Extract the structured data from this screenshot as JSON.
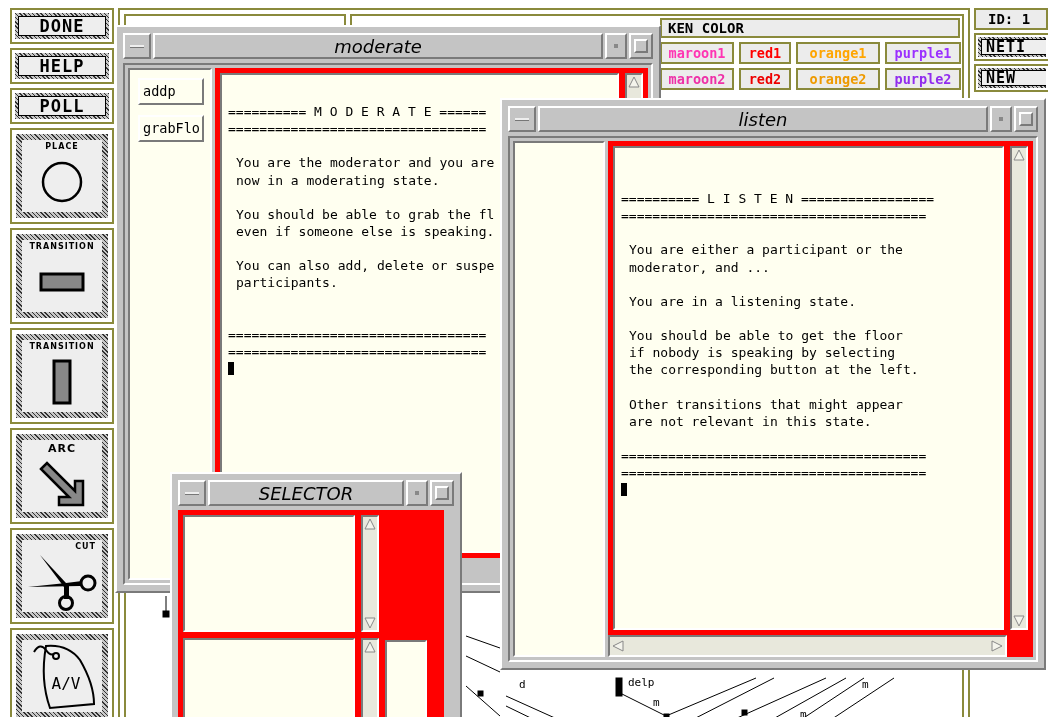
{
  "toolbar": {
    "buttons": [
      "DONE",
      "HELP",
      "POLL"
    ],
    "tools": [
      {
        "kind": "place",
        "label": "PLACE"
      },
      {
        "kind": "transition_horizontal",
        "label": "TRANSITION"
      },
      {
        "kind": "transition_vertical",
        "label": "TRANSITION"
      },
      {
        "kind": "arc",
        "label": "ARC"
      },
      {
        "kind": "cut",
        "label": "CUT"
      },
      {
        "kind": "tag",
        "label": "A/V"
      }
    ]
  },
  "color_panel": {
    "header": "KEN COLOR",
    "colors": [
      {
        "label": "maroon1",
        "color": "#ff34b3"
      },
      {
        "label": "red1",
        "color": "#ff0000"
      },
      {
        "label": "orange1",
        "color": "#ffa500"
      },
      {
        "label": "purple1",
        "color": "#9b30ff"
      },
      {
        "label": "maroon2",
        "color": "#ee30a7"
      },
      {
        "label": "red2",
        "color": "#ee0000"
      },
      {
        "label": "orange2",
        "color": "#ee9a00"
      },
      {
        "label": "purple2",
        "color": "#912cee"
      }
    ]
  },
  "side_panel": {
    "id": "ID: 1",
    "buttons": [
      "NETI",
      "NEW"
    ]
  },
  "diagram": {
    "labels": [
      "d",
      "delp",
      "m",
      "m",
      "m"
    ]
  },
  "windows": [
    {
      "kind": "text_window",
      "title": "moderate",
      "side_buttons": [
        "addp",
        "grabFlo"
      ],
      "cursor": true,
      "blocks": [
        {
          "kind": "rule",
          "text": "========== M O D E R A T E ======"
        },
        {
          "kind": "rule",
          "text": "================================="
        },
        {
          "kind": "paragraph",
          "text": "You are the moderator and you are\nnow in a moderating state."
        },
        {
          "kind": "paragraph",
          "text": "You should be able to grab the fl\neven if someone else is speaking."
        },
        {
          "kind": "paragraph",
          "text": "You can also add, delete or suspe\nparticipants."
        },
        {
          "kind": "rule",
          "text": "================================="
        },
        {
          "kind": "rule",
          "text": "================================="
        }
      ]
    },
    {
      "kind": "text_window",
      "title": "listen",
      "cursor": true,
      "blocks": [
        {
          "kind": "rule",
          "text": "========== L I S T E N ================="
        },
        {
          "kind": "rule",
          "text": "======================================="
        },
        {
          "kind": "paragraph",
          "text": "You are either a participant or the\nmoderator, and ..."
        },
        {
          "kind": "paragraph",
          "text": "You are in a listening state."
        },
        {
          "kind": "paragraph",
          "text": "You should be able to get the floor\nif nobody is speaking by selecting\nthe corresponding button at the left."
        },
        {
          "kind": "paragraph",
          "text": "Other transitions that might appear\nare not relevant in this state."
        },
        {
          "kind": "rule",
          "text": "======================================="
        },
        {
          "kind": "rule",
          "text": "======================================="
        }
      ]
    },
    {
      "kind": "selector",
      "title": "SELECTOR"
    }
  ]
}
